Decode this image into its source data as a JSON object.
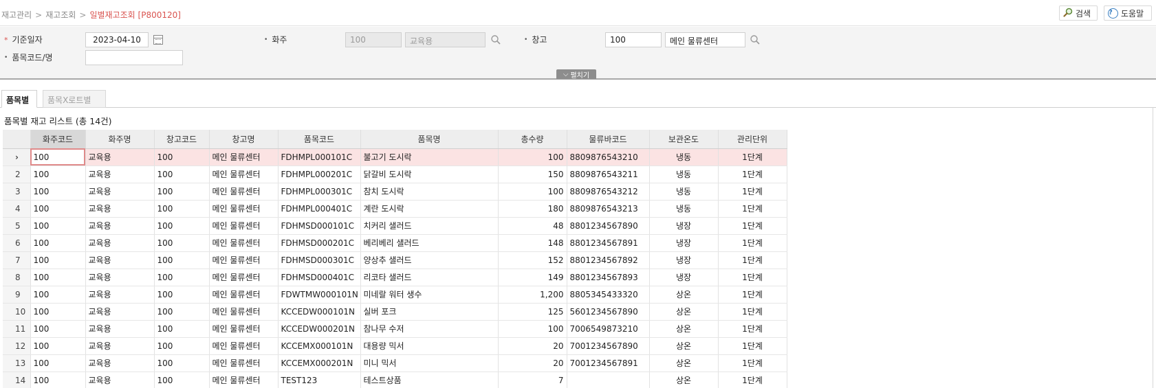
{
  "breadcrumb": {
    "level1": "재고관리",
    "level2": "재고조회",
    "current": "일별재고조회 [P800120]"
  },
  "toolbar": {
    "search_label": "검색",
    "help_label": "도움말"
  },
  "search": {
    "base_date_label": "기준일자",
    "base_date_value": "2023-04-10",
    "owner_label": "화주",
    "owner_code": "100",
    "owner_name": "교육용",
    "warehouse_label": "창고",
    "warehouse_code": "100",
    "warehouse_name": "메인 물류센터",
    "item_label": "품목코드/명",
    "item_value": "",
    "expand_label": "펼치기"
  },
  "tabs": [
    {
      "label": "품목별"
    },
    {
      "label": "품목X로트별"
    }
  ],
  "list": {
    "title": "품목별 재고 리스트 (총 14건)",
    "selected_marker": "›",
    "columns": [
      "화주코드",
      "화주명",
      "창고코드",
      "창고명",
      "품목코드",
      "품목명",
      "총수량",
      "물류바코드",
      "보관온도",
      "관리단위"
    ],
    "rows": [
      [
        "100",
        "교육용",
        "100",
        "메인 물류센터",
        "FDHMPL000101C",
        "불고기 도시락",
        "100",
        "8809876543210",
        "냉동",
        "1단계"
      ],
      [
        "100",
        "교육용",
        "100",
        "메인 물류센터",
        "FDHMPL000201C",
        "닭갈비 도시락",
        "150",
        "8809876543211",
        "냉동",
        "1단계"
      ],
      [
        "100",
        "교육용",
        "100",
        "메인 물류센터",
        "FDHMPL000301C",
        "참치 도시락",
        "100",
        "8809876543212",
        "냉동",
        "1단계"
      ],
      [
        "100",
        "교육용",
        "100",
        "메인 물류센터",
        "FDHMPL000401C",
        "계란 도시락",
        "180",
        "8809876543213",
        "냉동",
        "1단계"
      ],
      [
        "100",
        "교육용",
        "100",
        "메인 물류센터",
        "FDHMSD000101C",
        "치커리 샐러드",
        "48",
        "8801234567890",
        "냉장",
        "1단계"
      ],
      [
        "100",
        "교육용",
        "100",
        "메인 물류센터",
        "FDHMSD000201C",
        "베리베리 샐러드",
        "148",
        "8801234567891",
        "냉장",
        "1단계"
      ],
      [
        "100",
        "교육용",
        "100",
        "메인 물류센터",
        "FDHMSD000301C",
        "양상추 샐러드",
        "152",
        "8801234567892",
        "냉장",
        "1단계"
      ],
      [
        "100",
        "교육용",
        "100",
        "메인 물류센터",
        "FDHMSD000401C",
        "리코타 샐러드",
        "149",
        "8801234567893",
        "냉장",
        "1단계"
      ],
      [
        "100",
        "교육용",
        "100",
        "메인 물류센터",
        "FDWTMW000101N",
        "미네랄 워터 생수",
        "1,200",
        "8805345433320",
        "상온",
        "1단계"
      ],
      [
        "100",
        "교육용",
        "100",
        "메인 물류센터",
        "KCCEDW000101N",
        "실버 포크",
        "125",
        "5601234567890",
        "상온",
        "1단계"
      ],
      [
        "100",
        "교육용",
        "100",
        "메인 물류센터",
        "KCCEDW000201N",
        "참나무 수저",
        "100",
        "7006549873210",
        "상온",
        "1단계"
      ],
      [
        "100",
        "교육용",
        "100",
        "메인 물류센터",
        "KCCEMX000101N",
        "대용량 믹서",
        "20",
        "7001234567890",
        "상온",
        "1단계"
      ],
      [
        "100",
        "교육용",
        "100",
        "메인 물류센터",
        "KCCEMX000201N",
        "미니 믹서",
        "20",
        "7001234567891",
        "상온",
        "1단계"
      ],
      [
        "100",
        "교육용",
        "100",
        "메인 물류센터",
        "TEST123",
        "테스트상품",
        "7",
        "",
        "상온",
        "1단계"
      ]
    ]
  }
}
